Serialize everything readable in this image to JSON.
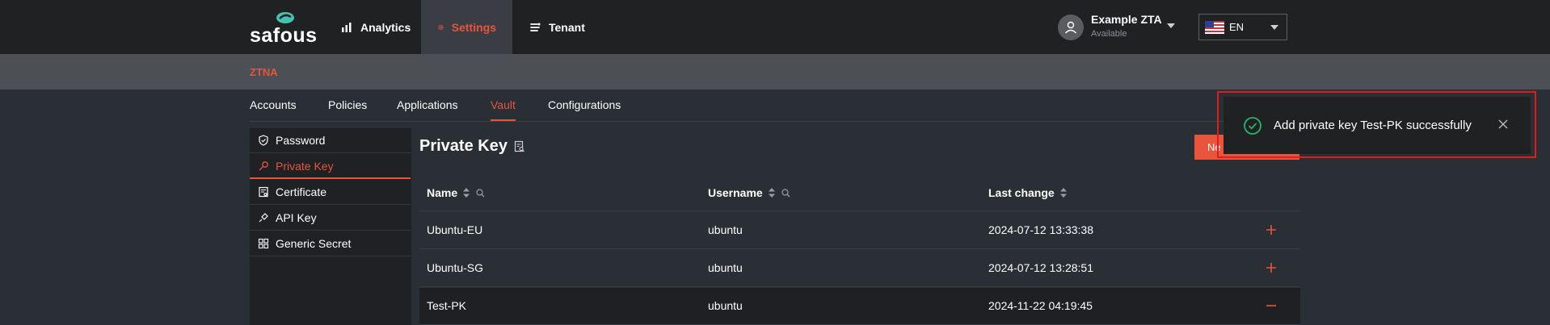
{
  "header": {
    "logo_text": "safous",
    "nav": [
      {
        "label": "Analytics",
        "icon": "analytics-icon"
      },
      {
        "label": "Settings",
        "icon": "gear-icon"
      },
      {
        "label": "Tenant",
        "icon": "tenant-icon"
      }
    ],
    "user": {
      "name": "Example ZTA",
      "status": "Available"
    },
    "language": {
      "selected": "EN",
      "flag": "us-flag-icon"
    }
  },
  "subbar": {
    "title": "ZTNA"
  },
  "tabs": [
    "Accounts",
    "Policies",
    "Applications",
    "Vault",
    "Configurations"
  ],
  "active_tab": "Vault",
  "sidemenu": {
    "items": [
      {
        "label": "Password",
        "icon": "shield-icon"
      },
      {
        "label": "Private Key",
        "icon": "key-icon"
      },
      {
        "label": "Certificate",
        "icon": "certificate-icon"
      },
      {
        "label": "API Key",
        "icon": "api-key-icon"
      },
      {
        "label": "Generic Secret",
        "icon": "grid-icon"
      }
    ],
    "active": "Private Key"
  },
  "main": {
    "title": "Private Key",
    "new_button_label": "Ne",
    "table": {
      "columns": [
        "Name",
        "Username",
        "Last change"
      ],
      "rows": [
        {
          "name": "Ubuntu-EU",
          "username": "ubuntu",
          "last_change": "2024-07-12 13:33:38",
          "action": "+"
        },
        {
          "name": "Ubuntu-SG",
          "username": "ubuntu",
          "last_change": "2024-07-12 13:28:51",
          "action": "+"
        },
        {
          "name": "Test-PK",
          "username": "ubuntu",
          "last_change": "2024-11-22 04:19:45",
          "action": "−"
        }
      ]
    }
  },
  "toast": {
    "message": "Add private key Test-PK successfully"
  },
  "colors": {
    "accent": "#e8553a",
    "topbar": "#202123",
    "background": "#2a2e35",
    "success": "#25b46e",
    "highlight_border": "#e01c1c"
  }
}
